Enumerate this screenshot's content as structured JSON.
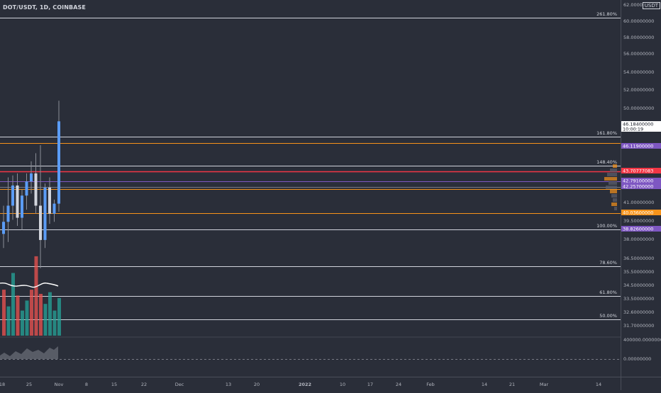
{
  "header": {
    "symbol": "DOT/USDT, 1D, COINBASE",
    "currency": "USDT"
  },
  "fib_levels": [
    {
      "label": "261.80%"
    },
    {
      "label": "161.80%"
    },
    {
      "label": "148.40%"
    },
    {
      "label": "100.00%"
    },
    {
      "label": "78.60%"
    },
    {
      "label": "61.80%"
    },
    {
      "label": "50.00%"
    }
  ],
  "price_ticks": [
    "62.00000000",
    "60.00000000",
    "58.00000000",
    "56.00000000",
    "54.00000000",
    "52.00000000",
    "50.00000000",
    "41.00000000",
    "39.50000000",
    "38.00000000",
    "36.50000000",
    "35.50000000",
    "34.50000000",
    "33.50000000",
    "32.60000000",
    "31.70000000",
    "400000.00000000",
    "0.00000000"
  ],
  "price_tags": [
    {
      "value": "46.18400000",
      "sub": "10:00:19",
      "color": "#ffffff",
      "text": "#131722"
    },
    {
      "value": "46.11900000",
      "color": "#7e57c2",
      "text": "#ffffff"
    },
    {
      "value": "43.70777083",
      "color": "#f23645",
      "text": "#ffffff"
    },
    {
      "value": "42.79100000",
      "color": "#7e57c2",
      "text": "#ffffff"
    },
    {
      "value": "42.25700000",
      "color": "#7e57c2",
      "text": "#ffffff"
    },
    {
      "value": "40.03600000",
      "color": "#f7931a",
      "text": "#ffffff"
    },
    {
      "value": "38.82600000",
      "color": "#7e57c2",
      "text": "#ffffff"
    }
  ],
  "time_ticks": [
    "18",
    "25",
    "Nov",
    "8",
    "15",
    "22",
    "Dec",
    "13",
    "20",
    "2022",
    "10",
    "17",
    "24",
    "Feb",
    "14",
    "21",
    "Mar",
    "14"
  ],
  "colors": {
    "bg": "#2a2e39",
    "up": "#5b9cf6",
    "down": "#ef5350",
    "vol_up": "#26a69a",
    "vol_down": "#ef5350",
    "fib": "#d1d4dc",
    "red_line": "#f23645",
    "orange_line": "#f7931a",
    "purple_line": "#7e57c2"
  },
  "chart_data": {
    "type": "candlestick",
    "candles": [
      {
        "o": 40.6,
        "h": 42.0,
        "l": 39.9,
        "c": 41.2
      },
      {
        "o": 41.2,
        "h": 43.4,
        "l": 40.2,
        "c": 42.0
      },
      {
        "o": 42.0,
        "h": 43.5,
        "l": 41.3,
        "c": 43.0
      },
      {
        "o": 43.0,
        "h": 43.6,
        "l": 41.0,
        "c": 41.4
      },
      {
        "o": 41.4,
        "h": 42.8,
        "l": 40.8,
        "c": 42.5
      },
      {
        "o": 42.5,
        "h": 43.6,
        "l": 41.8,
        "c": 43.2
      },
      {
        "o": 43.2,
        "h": 44.2,
        "l": 42.6,
        "c": 43.6
      },
      {
        "o": 43.6,
        "h": 44.6,
        "l": 41.6,
        "c": 42.0
      },
      {
        "o": 42.0,
        "h": 45.0,
        "l": 38.9,
        "c": 40.3
      },
      {
        "o": 40.3,
        "h": 43.1,
        "l": 39.9,
        "c": 42.9
      },
      {
        "o": 42.9,
        "h": 43.4,
        "l": 41.1,
        "c": 41.6
      },
      {
        "o": 41.6,
        "h": 42.3,
        "l": 41.2,
        "c": 42.1
      },
      {
        "o": 42.1,
        "h": 47.2,
        "l": 41.7,
        "c": 46.18
      }
    ],
    "volumes": [
      {
        "v": 0.55,
        "up": false
      },
      {
        "v": 0.35,
        "up": true
      },
      {
        "v": 0.75,
        "up": true
      },
      {
        "v": 0.48,
        "up": false
      },
      {
        "v": 0.3,
        "up": true
      },
      {
        "v": 0.42,
        "up": true
      },
      {
        "v": 0.55,
        "up": false
      },
      {
        "v": 0.95,
        "up": false
      },
      {
        "v": 0.5,
        "up": false
      },
      {
        "v": 0.38,
        "up": true
      },
      {
        "v": 0.52,
        "up": true
      },
      {
        "v": 0.3,
        "up": true
      },
      {
        "v": 0.45,
        "up": true
      }
    ]
  }
}
